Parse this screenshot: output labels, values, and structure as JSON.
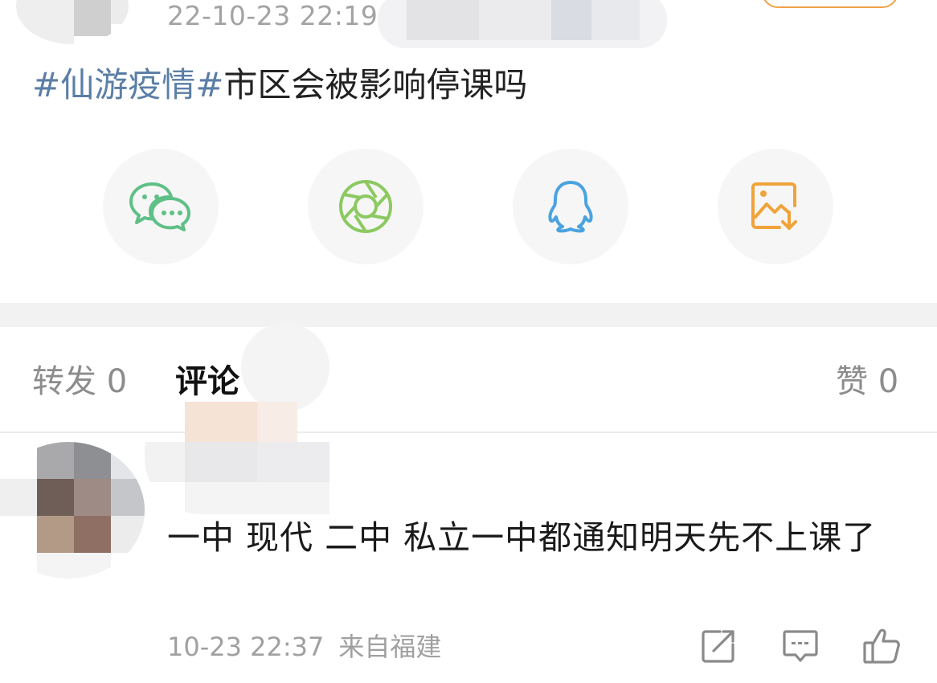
{
  "post": {
    "time": "22-10-23 22:19",
    "topic": "#仙游疫情#",
    "text": "市区会被影响停课吗"
  },
  "share_icons": [
    "wechat-icon",
    "moments-icon",
    "qq-icon",
    "save-image-icon"
  ],
  "colors": {
    "topic": "#5b7ea6",
    "wechat": "#5fc087",
    "moments": "#8cc961",
    "qq": "#4aa3e0",
    "save": "#f0a33a",
    "follow_border": "#f1a146"
  },
  "tabs": {
    "repost": "转发 0",
    "comment": "评论",
    "like": "赞 0"
  },
  "comment": {
    "text": "一中 现代 二中 私立一中都通知明天先不上课了",
    "time": "10-23 22:37",
    "location": "来自福建",
    "actions": [
      "share-icon",
      "reply-icon",
      "like-icon"
    ]
  }
}
